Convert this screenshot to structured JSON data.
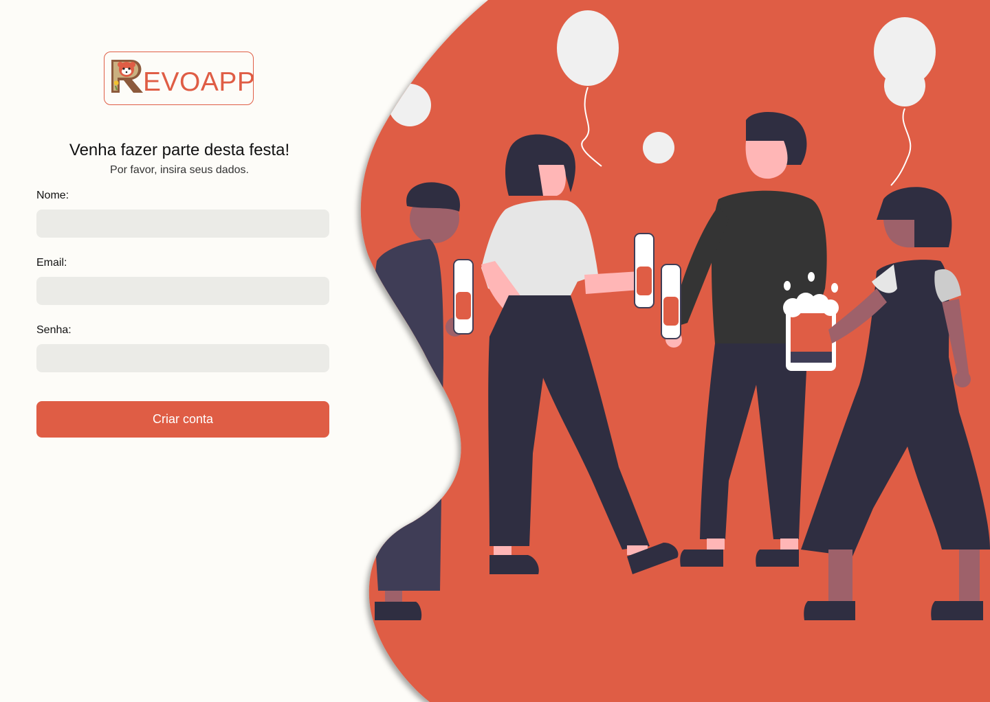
{
  "logo": {
    "text": "EVOAPP",
    "letter": "R"
  },
  "heading": "Venha fazer parte desta festa!",
  "subheading": "Por favor, insira seus dados.",
  "form": {
    "name": {
      "label": "Nome:",
      "value": "",
      "placeholder": ""
    },
    "email": {
      "label": "Email:",
      "value": "",
      "placeholder": ""
    },
    "password": {
      "label": "Senha:",
      "value": "",
      "placeholder": ""
    },
    "submit_label": "Criar conta"
  },
  "colors": {
    "accent": "#df5d45",
    "background": "#fdfcf8",
    "input_bg": "#ebebe7",
    "figure_dark": "#2f2e41",
    "balloon": "#f0f0f0"
  },
  "illustration": {
    "description_icon": "party-people-illustration"
  }
}
